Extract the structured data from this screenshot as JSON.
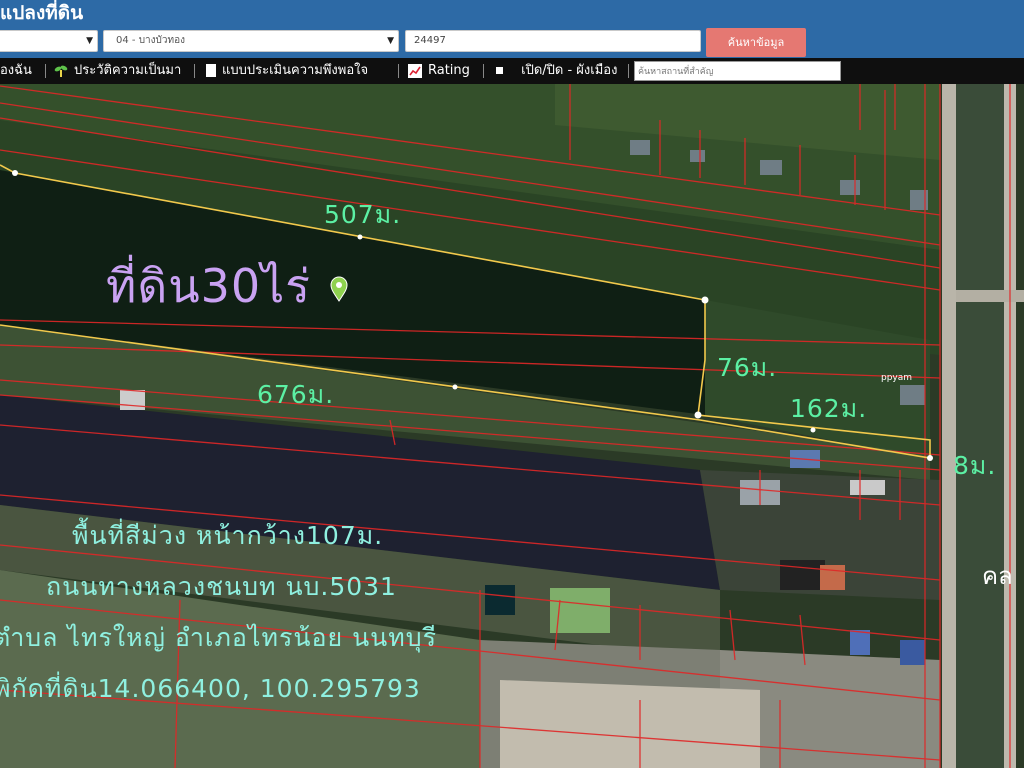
{
  "header": {
    "title": "แปลงที่ดิน",
    "amphoe_select": "04 - บางบัวทอง",
    "parcel_number": "24497",
    "search_button": "ค้นหาข้อมูล"
  },
  "toolbar": {
    "item1": "องฉัน",
    "history": "ประวัติความเป็นมา",
    "survey": "แบบประเมินความพึงพอใจ",
    "rating": "Rating",
    "toggle": "เปิด/ปิด - ผังเมือง",
    "place_search_placeholder": "ค้นหาสถานที่สำคัญ"
  },
  "map": {
    "title": "ที่ดิน30ไร่",
    "measurements": {
      "north": "507ม.",
      "south": "676ม.",
      "east_notch": "76ม.",
      "east_tail": "162ม.",
      "east_end": "8ม."
    },
    "info_lines": [
      "พื้นที่สีม่วง หน้ากว้าง107ม.",
      "ถนนทางหลวงชนบท นบ.5031",
      "ตำบล ไทรใหญ่ อำเภอไทรน้อย นนทบุรี",
      "พิกัดที่ดิน14.066400, 100.295793"
    ],
    "right_text": "คล",
    "building_label": "ppyam"
  },
  "colors": {
    "header": "#2d6aa6",
    "toolbar": "#0f0f0f",
    "button": "#e57872",
    "parcel_lines": "#e02727",
    "boundary": "#f2c94c",
    "measurement_text": "#5cf0a4",
    "info_text": "#8ff0e0",
    "title_text": "#c9a2f2"
  },
  "icons": [
    "history-sprout-icon",
    "document-icon",
    "rating-chart-icon",
    "square-icon",
    "map-pin-icon",
    "select-caret-icon"
  ]
}
